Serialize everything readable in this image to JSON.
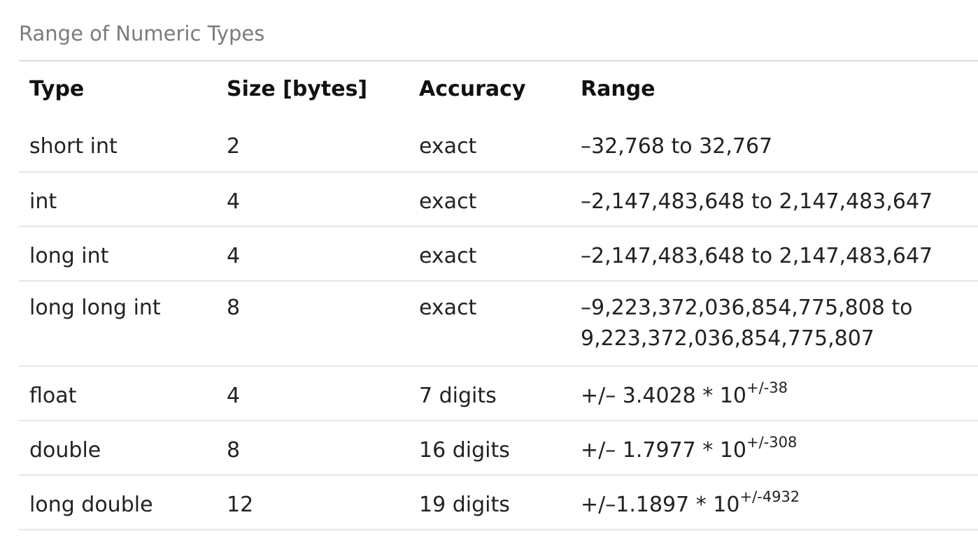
{
  "caption": "Range of Numeric Types",
  "headers": {
    "type": "Type",
    "size": "Size [bytes]",
    "accuracy": "Accuracy",
    "range": "Range"
  },
  "rows": [
    {
      "type": "short int",
      "size": "2",
      "accuracy": "exact",
      "range_line1": "–32,768 to 32,767"
    },
    {
      "type": "int",
      "size": "4",
      "accuracy": "exact",
      "range_line1": "–2,147,483,648 to 2,147,483,647"
    },
    {
      "type": "long int",
      "size": "4",
      "accuracy": "exact",
      "range_line1": "–2,147,483,648 to 2,147,483,647"
    },
    {
      "type": "long long int",
      "size": "8",
      "accuracy": "exact",
      "range_line1": "–9,223,372,036,854,775,808 to",
      "range_line2": "9,223,372,036,854,775,807"
    },
    {
      "type": "float",
      "size": "4",
      "accuracy": "7 digits",
      "range_base": "+/– 3.4028 * 10",
      "range_exp": "+/-38"
    },
    {
      "type": "double",
      "size": "8",
      "accuracy": "16 digits",
      "range_base": "+/– 1.7977 * 10",
      "range_exp": "+/-308"
    },
    {
      "type": "long double",
      "size": "12",
      "accuracy": "19 digits",
      "range_base": "+/–1.1897 * 10",
      "range_exp": "+/-4932"
    }
  ]
}
